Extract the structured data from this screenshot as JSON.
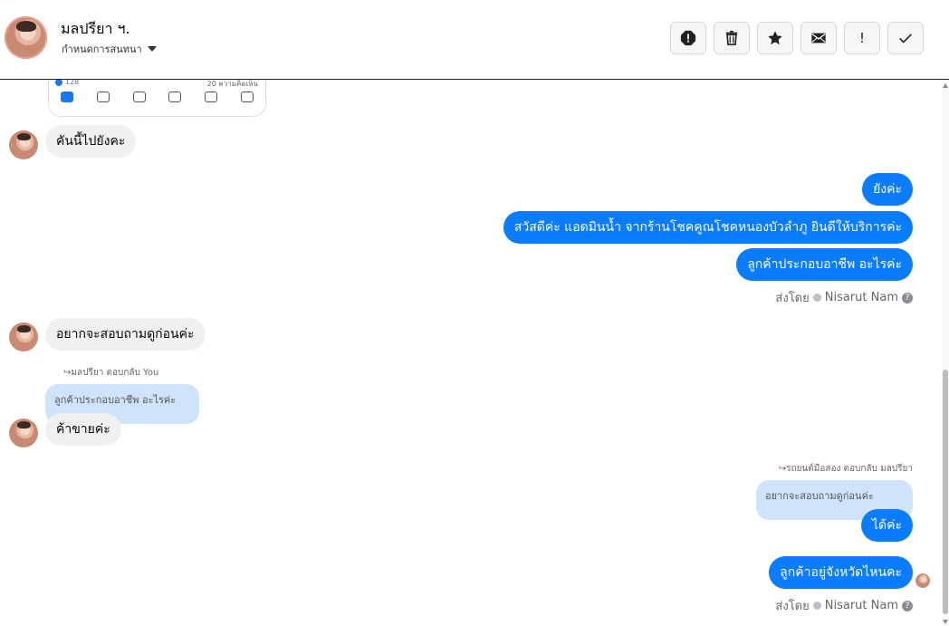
{
  "header": {
    "name": "มลปรียา ฯ.",
    "subtitle": "กำหนดการสนทนา",
    "buttons": [
      "spam-icon",
      "trash-icon",
      "star-icon",
      "mail-icon",
      "exclamation-icon",
      "check-icon"
    ],
    "exclaim_label": "!"
  },
  "shared_post": {
    "likes": "128",
    "comments": "20 ความคิดเห็น"
  },
  "messages": {
    "m1": "คันนี้ไปยังคะ",
    "m2": "ยังค่ะ",
    "m3": "สวัสดีค่ะ แอดมินน้ำ จากร้านโชคคูณโชคหนองบัวลำภู ยินดีให้บริการค่ะ",
    "m4": "ลูกค้าประกอบอาชีพ อะไรค่ะ",
    "sent_by_1": "ส่งโดย",
    "agent_1": "Nisarut Nam",
    "m5": "อยากจะสอบถามดูก่อนค่ะ",
    "reply_note_1": "มลปรียา ตอบกลับ You",
    "quote_1": "ลูกค้าประกอบอาชีพ อะไรค่ะ",
    "m6": "ค้าขายค่ะ",
    "reply_note_2": "รถยนต์มือสอง ตอบกลับ มลปรียา",
    "quote_2": "อยากจะสอบถามดูก่อนค่ะ",
    "m7": "ได้ค่ะ",
    "m8": "ลูกค้าอยู่จังหวัดไหนคะ",
    "sent_by_2": "ส่งโดย",
    "agent_2": "Nisarut Nam"
  },
  "colors": {
    "outgoing": "#0a7cff",
    "incoming": "#f0f0f0",
    "quote": "#cfe3fc"
  }
}
